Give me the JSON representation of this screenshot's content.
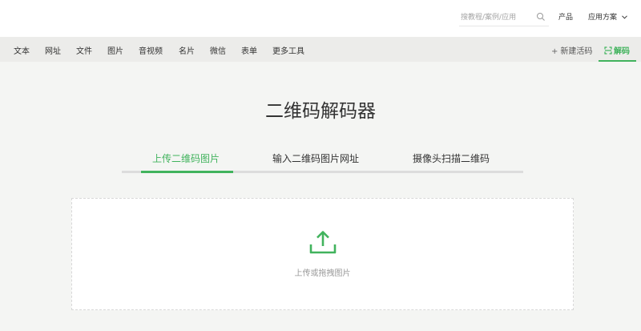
{
  "header": {
    "search": {
      "placeholder": "搜教程/案例/应用",
      "value": ""
    },
    "links": {
      "products": "产品",
      "solutions": "应用方案"
    }
  },
  "nav": {
    "items": [
      "文本",
      "网址",
      "文件",
      "图片",
      "音视频",
      "名片",
      "微信",
      "表单",
      "更多工具"
    ],
    "new_code": "新建活码",
    "decode": "解码"
  },
  "main": {
    "title": "二维码解码器",
    "tabs": [
      "上传二维码图片",
      "输入二维码图片网址",
      "摄像头扫描二维码"
    ],
    "active_tab": 0,
    "upload_hint": "上传或拖拽图片"
  },
  "colors": {
    "accent": "#41b35d",
    "nav_bg": "#ececea",
    "page_bg": "#f4f5f3"
  },
  "icons": {
    "search": "search-icon",
    "chevron": "chevron-down-icon",
    "plus": "plus-icon",
    "decode": "scan-icon",
    "upload": "upload-icon"
  }
}
